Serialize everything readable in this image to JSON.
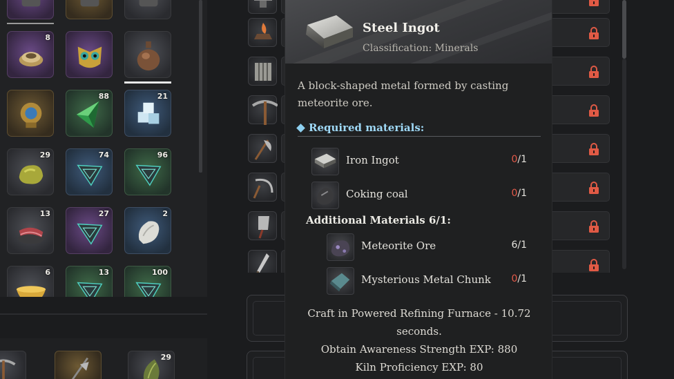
{
  "inventory": {
    "slots": [
      {
        "count": "",
        "tier": "purple"
      },
      {
        "count": "",
        "tier": "gold"
      },
      {
        "count": "",
        "tier": "grey"
      },
      {
        "count": "8",
        "tier": "purple",
        "icon": "coin-pouch-icon"
      },
      {
        "count": "",
        "tier": "purple",
        "icon": "owl-mask-icon"
      },
      {
        "count": "",
        "tier": "grey",
        "icon": "water-flask-icon"
      },
      {
        "count": "",
        "tier": "gold",
        "icon": "ornate-relic-icon"
      },
      {
        "count": "88",
        "tier": "green",
        "icon": "green-crystal-icon"
      },
      {
        "count": "21",
        "tier": "blue",
        "icon": "ice-cubes-icon"
      },
      {
        "count": "29",
        "tier": "grey",
        "icon": "ore-lump-icon"
      },
      {
        "count": "74",
        "tier": "blue",
        "icon": "rune-prism-icon"
      },
      {
        "count": "96",
        "tier": "green",
        "icon": "rune-prism-icon"
      },
      {
        "count": "13",
        "tier": "grey",
        "icon": "raw-meat-icon"
      },
      {
        "count": "27",
        "tier": "purple",
        "icon": "rune-prism-icon"
      },
      {
        "count": "2",
        "tier": "blue",
        "icon": "white-stone-icon"
      },
      {
        "count": "6",
        "tier": "grey",
        "icon": "gold-bowl-icon"
      },
      {
        "count": "13",
        "tier": "green",
        "icon": "rune-prism-icon"
      },
      {
        "count": "100",
        "tier": "green",
        "icon": "rune-prism-icon"
      }
    ]
  },
  "hotbar": {
    "slots": [
      {
        "count": "",
        "icon": "pickaxe-icon"
      },
      {
        "count": "",
        "icon": "halberd-icon"
      },
      {
        "count": "29",
        "icon": "seed-pod-icon"
      }
    ]
  },
  "recipes": {
    "icons": [
      "anvil-icon",
      "campfire-icon",
      "crate-icon",
      "pickaxe-icon",
      "axe-icon",
      "sickle-icon",
      "cleaver-icon",
      "dagger-icon"
    ]
  },
  "tooltip": {
    "item_name": "Steel Ingot",
    "classification": "Classification: Minerals",
    "description": "A block-shaped metal formed by casting meteorite ore.",
    "required_header": "Required materials:",
    "required": [
      {
        "name": "Iron Ingot",
        "have": "0",
        "need": "/1",
        "status": "red",
        "icon": "iron-ingot-icon"
      },
      {
        "name": "Coking coal",
        "have": "0",
        "need": "/1",
        "status": "red",
        "icon": "coal-icon"
      }
    ],
    "additional_header": "Additional Materials 6/1:",
    "additional": [
      {
        "name": "Meteorite Ore",
        "have": "6",
        "need": "/1",
        "status": "ok",
        "icon": "meteorite-ore-icon"
      },
      {
        "name": "Mysterious Metal Chunk",
        "have": "0",
        "need": "/1",
        "status": "red",
        "icon": "metal-chunk-icon"
      }
    ],
    "craft_line1": "Craft in Powered Refining Furnace - 10.72",
    "craft_line2": "seconds.",
    "exp_line1": "Obtain Awareness Strength EXP: 880",
    "exp_line2": "Kiln Proficiency EXP: 80"
  },
  "colors": {
    "lock": "#e05a45",
    "required_header": "#9ed8f6",
    "missing_qty": "#e45a4a"
  }
}
